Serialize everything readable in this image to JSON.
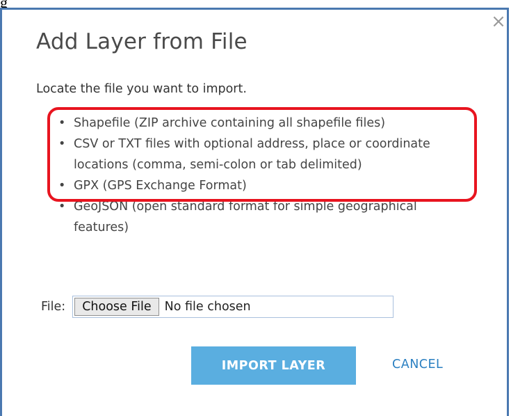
{
  "page_fragment": "g",
  "dialog": {
    "title": "Add Layer from File",
    "close_symbol": "×",
    "close_icon": "close-icon",
    "instructions": "Locate the file you want to import.",
    "formats": [
      "Shapefile (ZIP archive containing all shapefile files)",
      "CSV or TXT files with optional address, place or coordinate locations (comma, semi-colon or tab delimited)",
      "GPX (GPS Exchange Format)",
      "GeoJSON (open standard format for simple geographical features)"
    ],
    "bullet_symbol": "•",
    "file_input": {
      "label": "File:",
      "button_label": "Choose File",
      "status": "No file chosen"
    },
    "import_button_label": "IMPORT LAYER",
    "cancel_label": "CANCEL",
    "colors": {
      "frame_border": "#4a78b0",
      "primary_button": "#5aaee0",
      "link": "#2a7fc1",
      "highlight": "#e8141f"
    }
  }
}
